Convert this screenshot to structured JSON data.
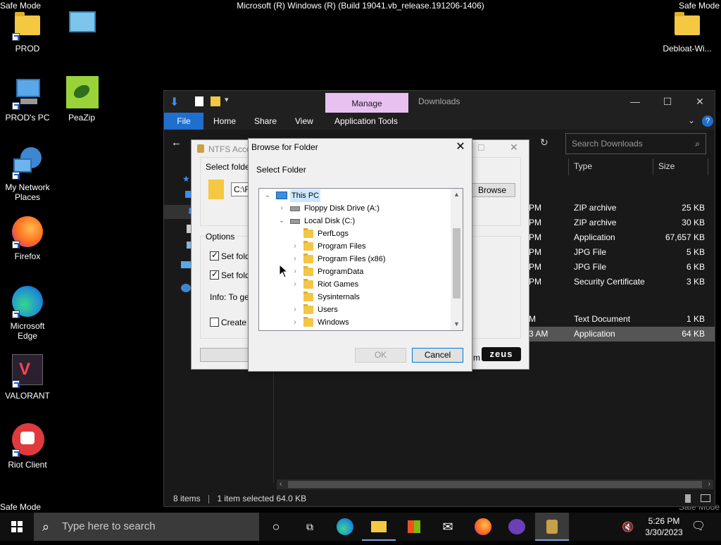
{
  "desktop": {
    "corner_top_left": "Safe Mode",
    "corner_top_right": "Safe Mode",
    "corner_bottom_left": "Safe Mode",
    "corner_bottom_right": "Safe Mode",
    "build": "Microsoft (R) Windows (R) (Build 19041.vb_release.191206-1406)",
    "icons": [
      {
        "label": "PROD"
      },
      {
        "label": "PROD's PC"
      },
      {
        "label": "PeaZip"
      },
      {
        "label": "My Network Places"
      },
      {
        "label": "Firefox"
      },
      {
        "label": "Microsoft Edge"
      },
      {
        "label": "VALORANT"
      },
      {
        "label": "Riot Client"
      },
      {
        "label": "Debloat-Wi..."
      }
    ]
  },
  "explorer": {
    "manage_tab": "Manage",
    "title": "Downloads",
    "ribbon_tabs": [
      "File",
      "Home",
      "Share",
      "View",
      "Application Tools"
    ],
    "search_placeholder": "Search Downloads",
    "columns": {
      "type": "Type",
      "size": "Size"
    },
    "rows": [
      {
        "time": "PM",
        "type": "ZIP archive",
        "size": "25 KB"
      },
      {
        "time": "PM",
        "type": "ZIP archive",
        "size": "30 KB"
      },
      {
        "time": "PM",
        "type": "Application",
        "size": "67,657 KB"
      },
      {
        "time": "PM",
        "type": "JPG File",
        "size": "5 KB"
      },
      {
        "time": "PM",
        "type": "JPG File",
        "size": "6 KB"
      },
      {
        "time": "PM",
        "type": "Security Certificate",
        "size": "3 KB"
      },
      {
        "time": "M",
        "type": "Text Document",
        "size": "1 KB"
      },
      {
        "time": "3 AM",
        "type": "Application",
        "size": "64 KB"
      }
    ],
    "status": {
      "items": "8 items",
      "selected": "1 item selected  64.0 KB"
    }
  },
  "ntfs": {
    "title": "NTFS Acce",
    "select_folder": "Select folder",
    "path": "C:\\F",
    "browse": "Browse",
    "options": "Options",
    "opt1": "Set folde",
    "opt2": "Set folde",
    "info": "Info: To get",
    "opt3": "Create l",
    "zeus": "zeus",
    "m_text": "m"
  },
  "bff": {
    "title": "Browse for Folder",
    "subtitle": "Select Folder",
    "tree": [
      {
        "label": "This PC"
      },
      {
        "label": "Floppy Disk Drive (A:)"
      },
      {
        "label": "Local Disk (C:)"
      },
      {
        "label": "PerfLogs"
      },
      {
        "label": "Program Files"
      },
      {
        "label": "Program Files (x86)"
      },
      {
        "label": "ProgramData"
      },
      {
        "label": "Riot Games"
      },
      {
        "label": "Sysinternals"
      },
      {
        "label": "Users"
      },
      {
        "label": "Windows"
      }
    ],
    "ok": "OK",
    "cancel": "Cancel"
  },
  "taskbar": {
    "search_placeholder": "Type here to search",
    "time": "5:26 PM",
    "date": "3/30/2023"
  },
  "colors": {
    "accent": "#1f6fcf",
    "manage_tab": "#e8c1f0",
    "desktop": "#000000"
  }
}
